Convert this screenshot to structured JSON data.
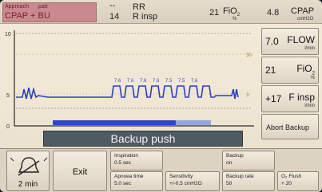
{
  "header": {
    "mode_line1a": "Approach",
    "mode_line1b": "patt",
    "mode_line2": "CPAP + BU",
    "rr_top": "--",
    "rr_label": "RR",
    "rr_value": "14",
    "rr_sub": "R insp",
    "fio2_value": "21",
    "fio2_label": "FiO",
    "fio2_sub": "2",
    "fio2_unit": "%",
    "cpap_value": "4.8",
    "cpap_label": "CPAP",
    "cpap_unit": "cmH2O"
  },
  "waveform": {
    "y_ticks": [
      "10",
      "5",
      "0"
    ],
    "peak_labels": [
      "7.6",
      "7.6",
      "7.6",
      "7.6",
      "7.5",
      "7.5",
      "7.6"
    ],
    "progress_fraction": 0.78
  },
  "banner": {
    "text": "Backup push"
  },
  "right_panel": [
    {
      "value": "7.0",
      "name": "FLOW",
      "unit": "l/min"
    },
    {
      "value": "21",
      "name": "FiO",
      "sub": "2",
      "unit": "%"
    },
    {
      "value": "+17",
      "name": "F insp",
      "unit": "l/min"
    },
    {
      "abort": "Abort Backup"
    }
  ],
  "bottom": {
    "alarm_time": "2 min",
    "exit_label": "Exit",
    "inspiration": {
      "line1": "Inspiration",
      "line2": "0.5  sec"
    },
    "apnoea": {
      "line1": "Apnoea time",
      "line2": "5.0  sec"
    },
    "sensitivity": {
      "line1": "Sensitivity",
      "line2": "+/-0.5  cmH2O"
    },
    "backup": {
      "line1": "Backup",
      "line2": "on"
    },
    "backup_rate": {
      "line1": "Backup rate",
      "line2": "50"
    },
    "o2_flush": {
      "line1": "O₂ Flush",
      "line2": "+ 20"
    }
  },
  "colors": {
    "waveform": "#2a3fc0",
    "banner": "#4f5b63",
    "mode": "#c98a8f"
  }
}
